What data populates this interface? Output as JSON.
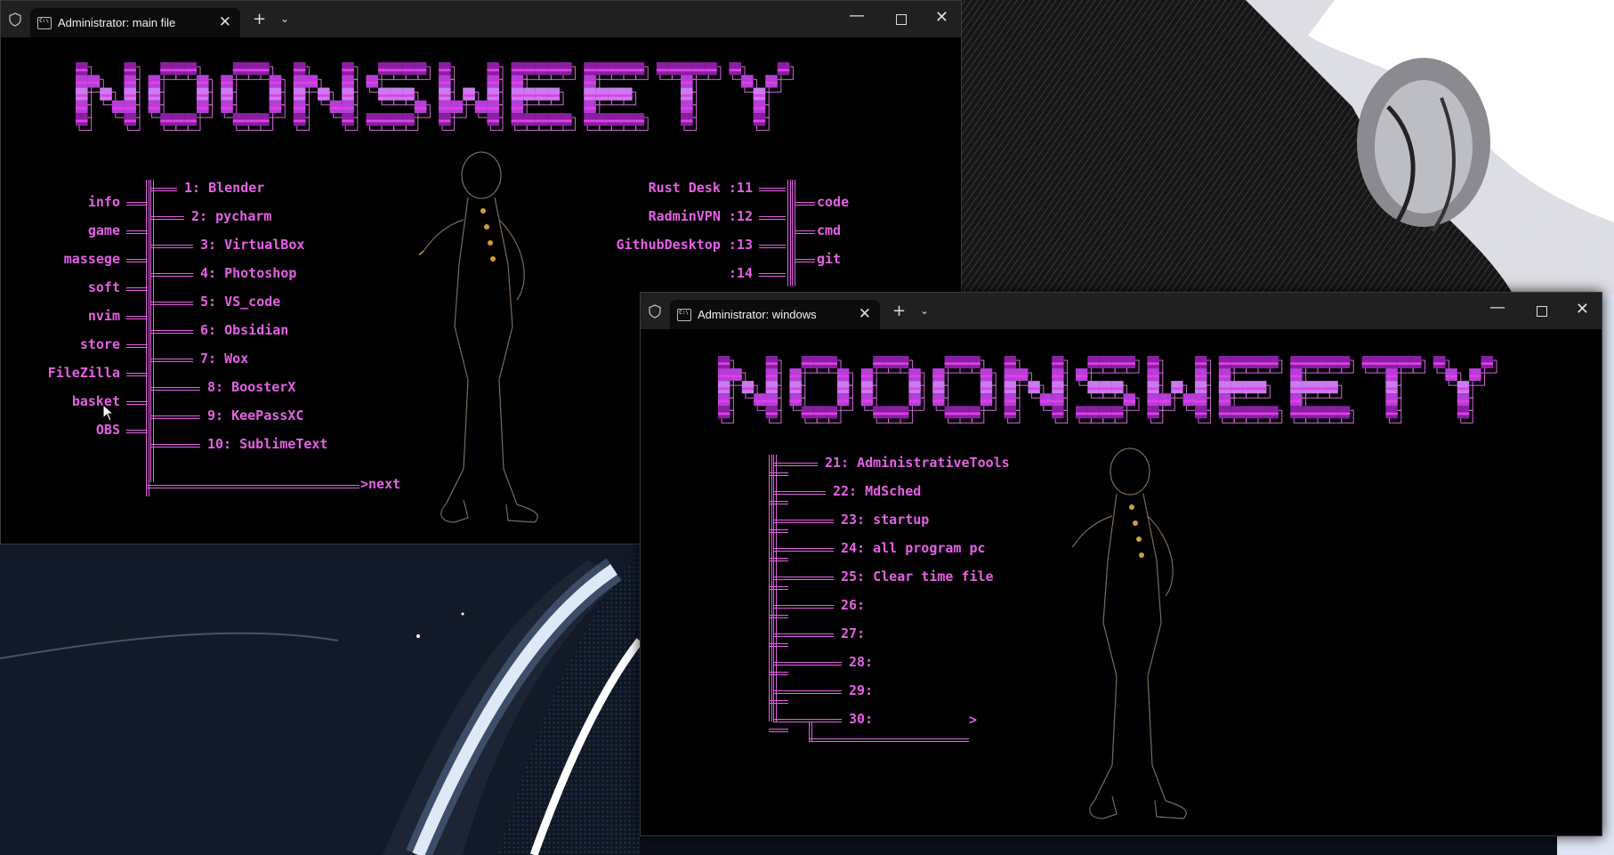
{
  "colors": {
    "accent": "#e561e5",
    "banner_dark": "#8a1fa3",
    "banner_mid": "#b73dd9",
    "banner_light": "#c97cf0"
  },
  "window_main": {
    "tab_title": "Administrator:  main file",
    "tab_close": "✕",
    "new_tab": "+",
    "dropdown": "⌄",
    "minimize": "—",
    "close": "✕",
    "banner_text": "NOONSWEETY",
    "left_labels": [
      "info",
      "game",
      "massege",
      "soft",
      "nvim",
      "store",
      "FileZilla",
      "basket",
      "OBS"
    ],
    "apps": [
      "1: Blender",
      "2: pycharm",
      "3: VirtualBox",
      "4: Photoshop",
      "5: VS_code",
      "6: Obsidian",
      "7: Wox",
      "8: BoosterX",
      "9: KeePassXC",
      "10: SublimeText"
    ],
    "right_apps": [
      "Rust Desk :11",
      "RadminVPN :12",
      "GithubDesktop :13",
      ":14"
    ],
    "right_labels": [
      "code",
      "cmd",
      "git"
    ],
    "next_label": ">next"
  },
  "window_windows": {
    "tab_title": "Administrator:  windows",
    "tab_close": "✕",
    "new_tab": "+",
    "dropdown": "⌄",
    "minimize": "—",
    "close": "✕",
    "banner_text": "NOOONSWEETY",
    "items": [
      "21: AdministrativeTools",
      "22: MdSched",
      "23: startup",
      "24: all program pc",
      "25: Clear time file",
      "26:",
      "27:",
      "28:",
      "29:",
      "30:"
    ],
    "arrow_label": ">"
  },
  "icons": {
    "shield": "shield-icon",
    "terminal": "terminal-icon",
    "pointer": "mouse-pointer-icon"
  }
}
